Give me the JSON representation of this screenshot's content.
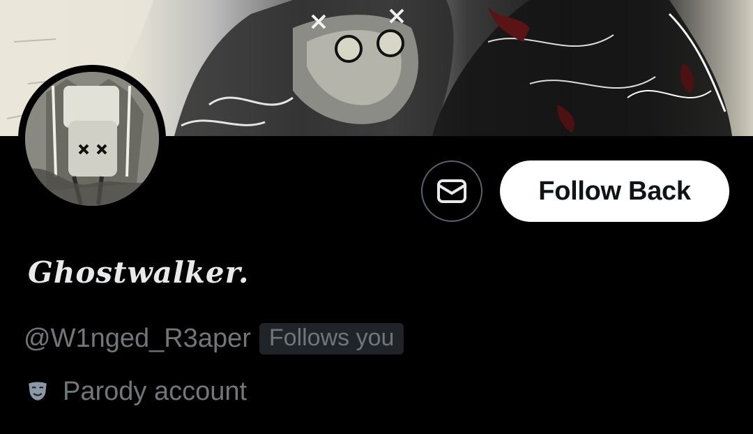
{
  "profile": {
    "display_name": "Ghostwalker.",
    "handle": "@W1nged_R3aper",
    "follows_you_badge": "Follows you",
    "label": "Parody account"
  },
  "actions": {
    "message_icon": "envelope-icon",
    "follow_label": "Follow Back"
  },
  "icons": {
    "label_icon": "theater-mask-icon"
  },
  "colors": {
    "background": "#000000",
    "primary_text": "#e7e9ea",
    "secondary_text": "#71767b",
    "follow_button_bg": "#ffffff",
    "follow_button_text": "#0f1419",
    "icon_button_border": "#536471",
    "badge_bg": "#202327"
  }
}
